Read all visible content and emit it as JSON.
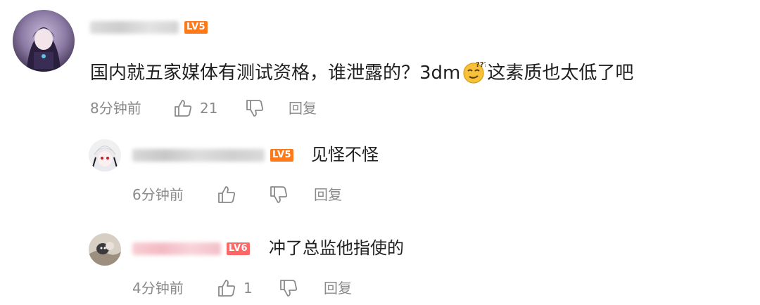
{
  "colors": {
    "text": "#1f1f1f",
    "meta": "#8a8a8a",
    "badge_orange": "#ff7a1a",
    "badge_pink": "#ff6666"
  },
  "main_comment": {
    "username": "",
    "level": "LV5",
    "text_before_emoji": "国内就五家媒体有测试资格，谁泄露的？3dm",
    "emoji": "thinking-face-emoji",
    "text_after_emoji": "这素质也太低了吧",
    "time": "8分钟前",
    "like_count": "21",
    "reply_label": "回复"
  },
  "replies": [
    {
      "username": "",
      "level": "LV5",
      "text": "见怪不怪",
      "time": "6分钟前",
      "like_count": "",
      "reply_label": "回复"
    },
    {
      "username": "",
      "level": "LV6",
      "text": "冲了总监他指使的",
      "time": "4分钟前",
      "like_count": "1",
      "reply_label": "回复"
    }
  ]
}
